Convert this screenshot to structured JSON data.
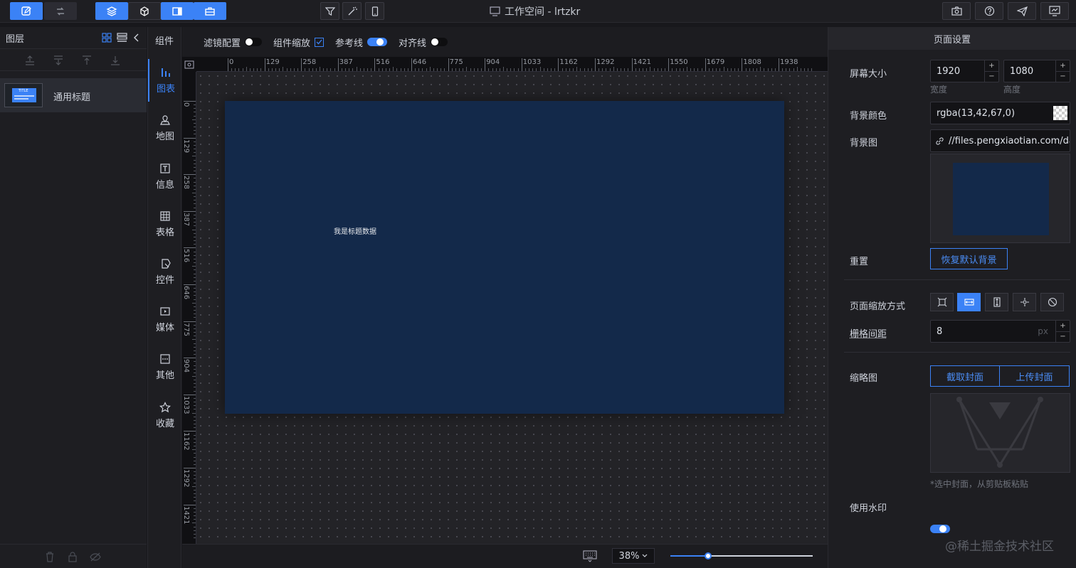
{
  "window": {
    "title": "工作空间 - lrtzkr"
  },
  "layers": {
    "title": "图层",
    "items": [
      {
        "name": "通用标题",
        "thumb_label": "TITLE"
      }
    ]
  },
  "categories": [
    {
      "label": "图表",
      "icon": "bar-chart-icon",
      "active": true
    },
    {
      "label": "地图",
      "icon": "map-pin-icon"
    },
    {
      "label": "信息",
      "icon": "text-icon"
    },
    {
      "label": "表格",
      "icon": "table-icon"
    },
    {
      "label": "控件",
      "icon": "cursor-icon"
    },
    {
      "label": "媒体",
      "icon": "play-icon"
    },
    {
      "label": "其他",
      "icon": "more-icon"
    },
    {
      "label": "收藏",
      "icon": "star-icon"
    }
  ],
  "category_header": "组件",
  "toolbar": {
    "filter_config": "滤镜配置",
    "component_zoom": "组件缩放",
    "guide_line": "参考线",
    "align_line": "对齐线"
  },
  "ruler": {
    "x_ticks": [
      "0",
      "129",
      "258",
      "387",
      "516",
      "646",
      "775",
      "904",
      "1033",
      "1162",
      "1292",
      "1421",
      "1550",
      "1679",
      "1808",
      "1938"
    ],
    "y_ticks": [
      "0",
      "129",
      "258",
      "387",
      "516",
      "646",
      "775",
      "904",
      "1033",
      "1162",
      "1292",
      "1421"
    ]
  },
  "canvas": {
    "screen_bg": "#13294a",
    "title_text": "我是标题数据"
  },
  "bottom": {
    "zoom": "38%",
    "zoom_level": 0.38
  },
  "settings": {
    "title": "页面设置",
    "screen_size_label": "屏幕大小",
    "width": "1920",
    "width_label": "宽度",
    "height": "1080",
    "height_label": "高度",
    "bg_color_label": "背景颜色",
    "bg_color": "rgba(13,42,67,0)",
    "bg_image_label": "背景图",
    "bg_image_url": "//files.pengxiaotian.com/datav",
    "reset_label": "重置",
    "reset_button": "恢复默认背景",
    "zoom_mode_label": "页面缩放方式",
    "grid_label": "栅格间距",
    "grid_value": "8",
    "grid_unit": "px",
    "thumbnail_label": "缩略图",
    "capture_button": "截取封面",
    "upload_button": "上传封面",
    "thumbnail_hint": "*选中封面，从剪贴板粘贴",
    "watermark_label": "使用水印"
  },
  "watermark_text": "@稀土掘金技术社区",
  "colors": {
    "accent": "#3b82f6",
    "panel": "#1e1e22",
    "canvas": "#232327"
  }
}
